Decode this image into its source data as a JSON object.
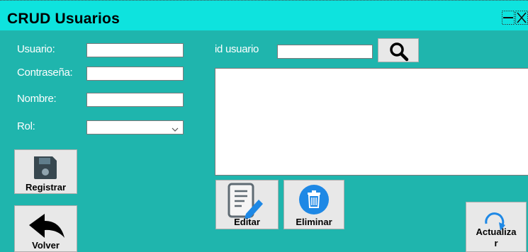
{
  "window": {
    "title": "CRUD Usuarios",
    "controls": [
      "minimize-icon",
      "close-icon"
    ]
  },
  "form": {
    "usuario_label": "Usuario:",
    "usuario_value": "",
    "contrasena_label": "Contraseña:",
    "contrasena_value": "",
    "nombre_label": "Nombre:",
    "nombre_value": "",
    "rol_label": "Rol:",
    "rol_value": ""
  },
  "search": {
    "id_label": "id usuario",
    "id_value": "",
    "button_icon": "search-icon"
  },
  "results": {
    "items": []
  },
  "buttons": {
    "registrar": "Registrar",
    "volver": "Volver",
    "editar": "Editar",
    "eliminar": "Eliminar",
    "actualizar_line1": "Actualiza",
    "actualizar_line2": "r"
  },
  "colors": {
    "background": "#1fb5ad",
    "titlebar": "#0ee3de",
    "label_text": "#ffffff",
    "button_face": "#e8e8e8",
    "delete_icon": "#1e88e5",
    "refresh_icon": "#1e88e5"
  }
}
